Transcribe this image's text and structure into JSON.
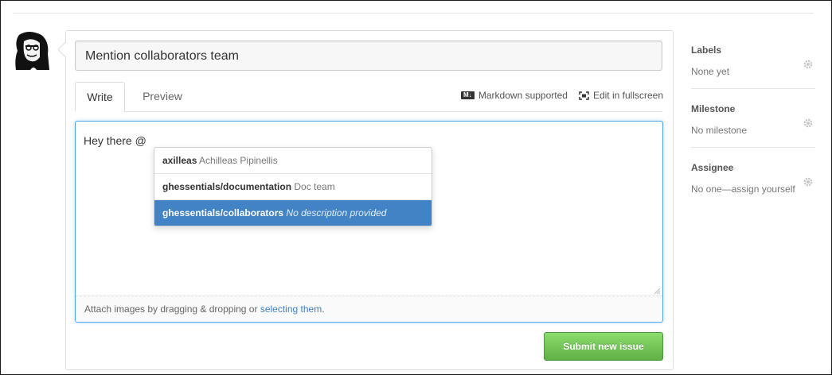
{
  "issue": {
    "title_value": "Mention collaborators team"
  },
  "tabs": {
    "write": "Write",
    "preview": "Preview"
  },
  "tools": {
    "markdown_label": "Markdown supported",
    "fullscreen_label": "Edit in fullscreen",
    "markdown_icon": "markdown-icon",
    "fullscreen_icon": "fullscreen-icon"
  },
  "editor": {
    "value": "Hey there @",
    "footer_text": "Attach images by dragging & dropping or ",
    "footer_link": "selecting them",
    "footer_end": "."
  },
  "suggestions": [
    {
      "handle": "axilleas",
      "description": "Achilleas Pipinellis",
      "selected": false
    },
    {
      "handle": "ghessentials/documentation",
      "description": "Doc team",
      "selected": false
    },
    {
      "handle": "ghessentials/collaborators",
      "description": "No description provided",
      "selected": true
    }
  ],
  "submit_label": "Submit new issue",
  "sidebar": {
    "labels": {
      "title": "Labels",
      "value": "None yet"
    },
    "milestone": {
      "title": "Milestone",
      "value": "No milestone"
    },
    "assignee": {
      "title": "Assignee",
      "value": "No one—assign yourself"
    }
  },
  "colors": {
    "accent": "#4183c4",
    "focus_border": "#51a7e8",
    "submit_green": "#60b044"
  }
}
